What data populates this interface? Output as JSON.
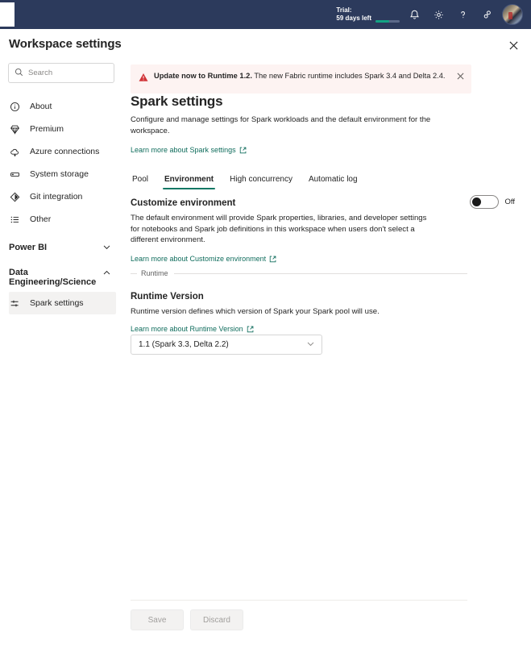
{
  "navbar": {
    "trial_label": "Trial:",
    "trial_days": "59 days left",
    "icons": {
      "notifications": "bell-icon",
      "settings": "gear-icon",
      "help": "question-mark-icon",
      "feedback": "feedback-icon",
      "avatar": "user-avatar"
    },
    "background": "#2c3a5c"
  },
  "header": {
    "title": "Workspace settings",
    "close_label": "×"
  },
  "sidebar": {
    "search": {
      "placeholder": "Search",
      "value": ""
    },
    "items": [
      {
        "label": "About",
        "icon": "info-icon"
      },
      {
        "label": "Premium",
        "icon": "diamond-icon"
      },
      {
        "label": "Azure connections",
        "icon": "cloud-icon"
      },
      {
        "label": "System storage",
        "icon": "storage-icon"
      },
      {
        "label": "Git integration",
        "icon": "git-icon"
      },
      {
        "label": "Other",
        "icon": "list-icon"
      }
    ],
    "groups": [
      {
        "label": "Power BI",
        "expanded": false,
        "chevron": "chevron-down-icon"
      },
      {
        "label": "Data Engineering/Science",
        "expanded": true,
        "chevron": "chevron-up-icon"
      }
    ],
    "active_item": {
      "label": "Spark settings",
      "icon": "sliders-icon"
    }
  },
  "banner": {
    "icon": "warning-triangle-icon",
    "bold_text": "Update now to Runtime 1.2.",
    "rest_text": " The new Fabric runtime includes Spark 3.4 and Delta 2.4.",
    "close_label": "×",
    "background": "#fdf3f2",
    "icon_color": "#d13438"
  },
  "main": {
    "title": "Spark settings",
    "description": "Configure and manage settings for Spark workloads and the default environment for the workspace.",
    "learn_more_spark": "Learn more about Spark settings",
    "tabs": [
      {
        "label": "Pool",
        "active": false
      },
      {
        "label": "Environment",
        "active": true
      },
      {
        "label": "High concurrency",
        "active": false
      },
      {
        "label": "Automatic log",
        "active": false
      }
    ],
    "accent_color": "#117865",
    "customize": {
      "title": "Customize environment",
      "description": "The default environment will provide Spark properties, libraries, and developer settings for notebooks and Spark job definitions in this workspace when users don't select a different environment.",
      "learn_more": "Learn more about Customize environment",
      "toggle_state": "Off"
    },
    "runtime_divider_label": "Runtime",
    "runtime": {
      "title": "Runtime Version",
      "description": "Runtime version defines which version of Spark your Spark pool will use.",
      "learn_more": "Learn more about Runtime Version",
      "selected_value": "1.1 (Spark 3.3, Delta 2.2)"
    },
    "footer": {
      "save_label": "Save",
      "discard_label": "Discard"
    }
  }
}
